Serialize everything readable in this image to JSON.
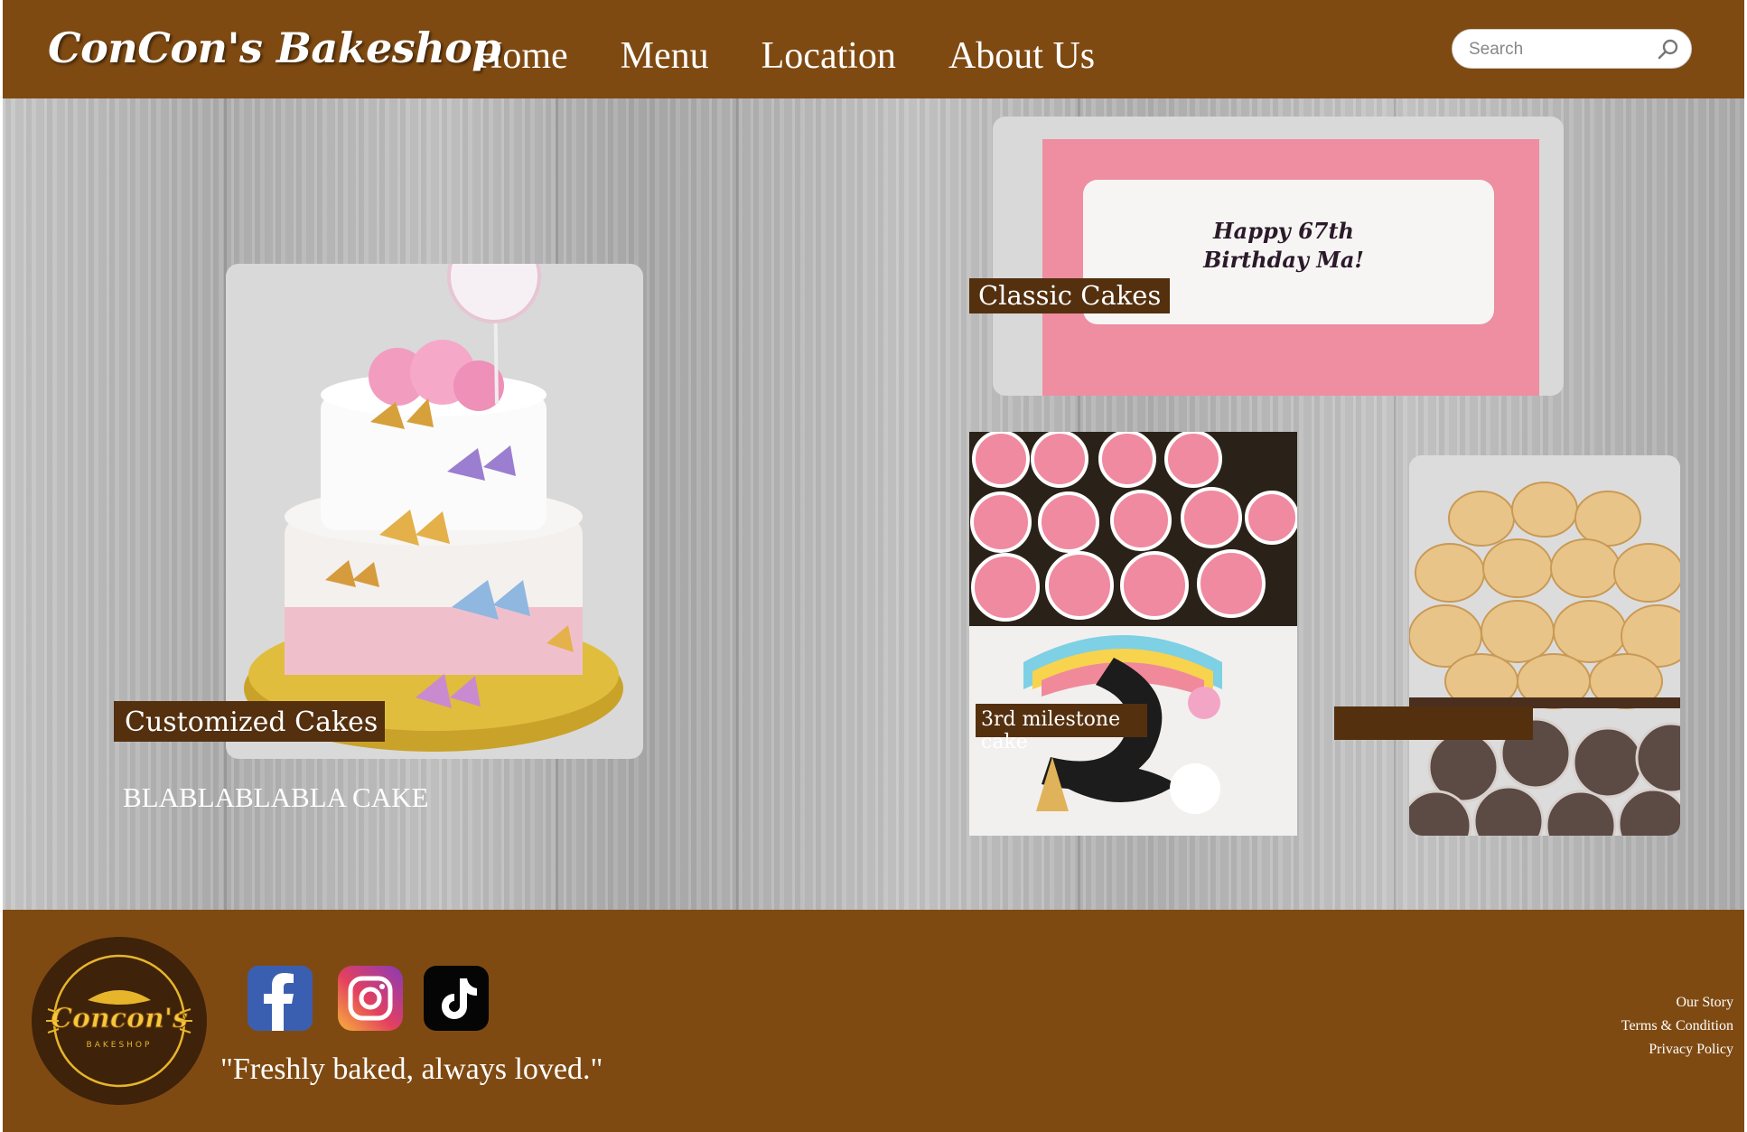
{
  "header": {
    "brand": "ConCon's Bakeshop",
    "nav": [
      "Home",
      "Menu",
      "Location",
      "About Us"
    ],
    "search_placeholder": "Search"
  },
  "main": {
    "customized": {
      "label": "Customized Cakes",
      "caption": "BLABLABLABLA CAKE"
    },
    "classic": {
      "label": "Classic Cakes",
      "cake_text_line1": "Happy 67th",
      "cake_text_line2": "Birthday Ma!"
    },
    "milestone": {
      "label": "3rd milestone cake"
    },
    "breads": {
      "label": ""
    }
  },
  "footer": {
    "logo_text": "Concon's",
    "logo_subtext": "BAKESHOP",
    "social": [
      "facebook-icon",
      "instagram-icon",
      "tiktok-icon"
    ],
    "tagline": "\"Freshly baked, always loved.\"",
    "links": [
      "Our Story",
      "Terms & Condition",
      "Privacy Policy"
    ]
  },
  "colors": {
    "header_brown": "#7f4a12",
    "label_brown": "#54300f",
    "panel_gray": "#d9d9d9"
  }
}
